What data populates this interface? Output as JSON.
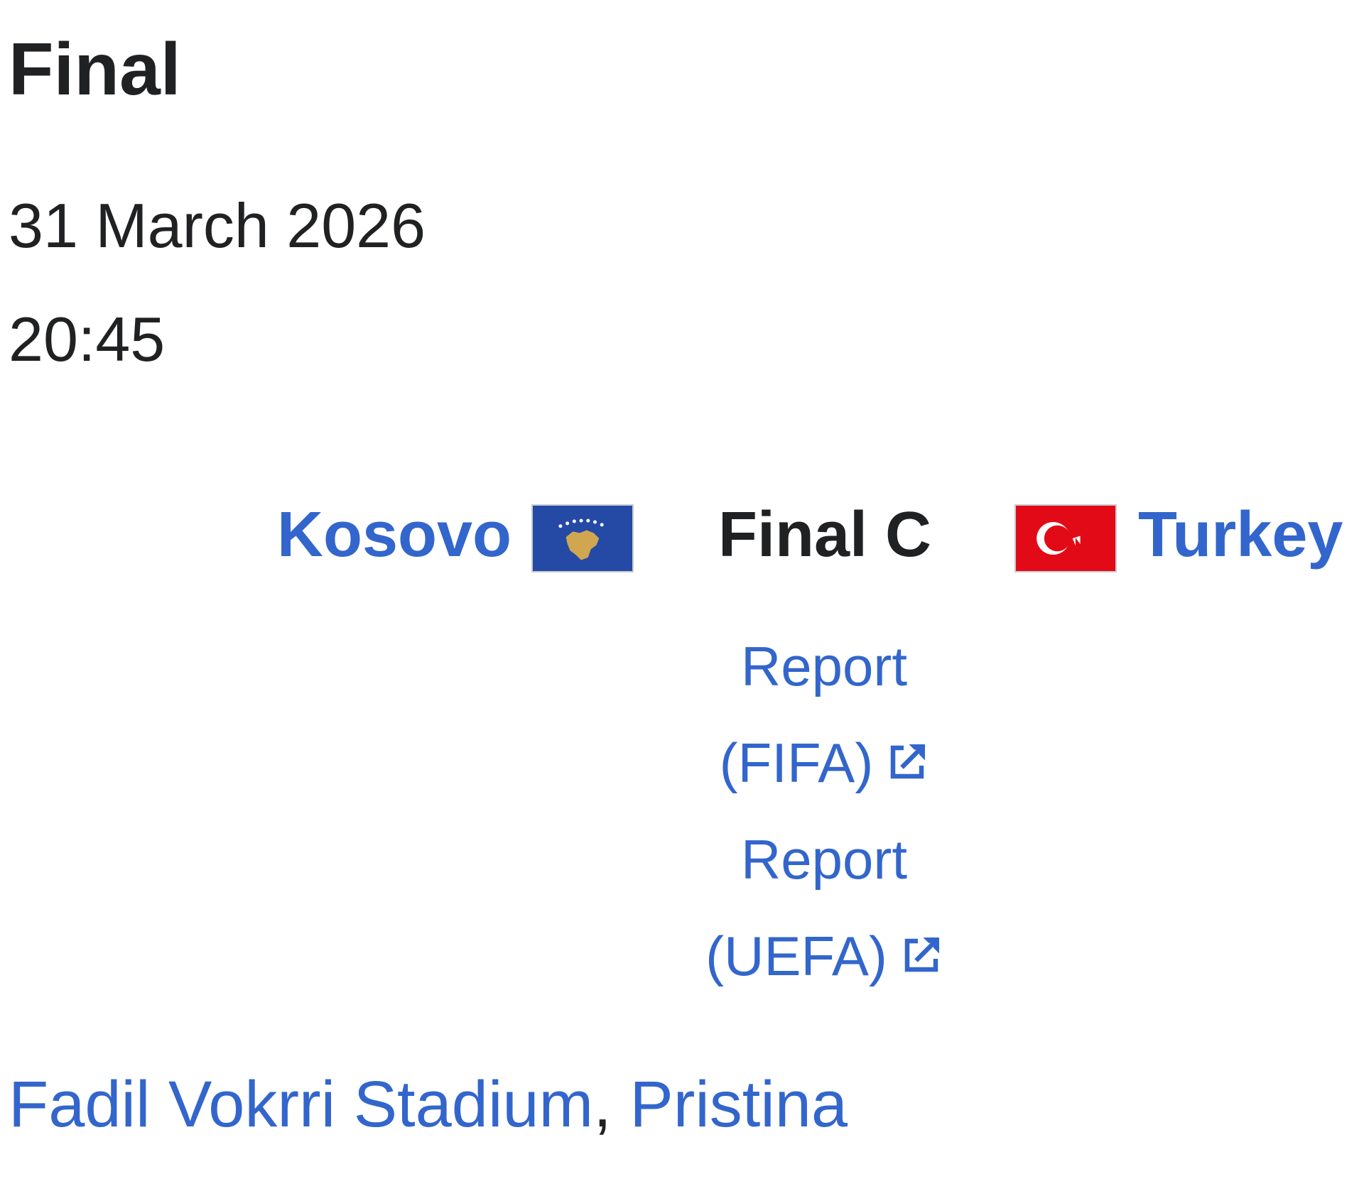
{
  "section": {
    "heading": "Final"
  },
  "match": {
    "date": "31 March 2026",
    "time": "20:45",
    "home_team": {
      "name": "Kosovo",
      "flag_icon": "kosovo-flag-icon"
    },
    "result": "Final C",
    "away_team": {
      "name": "Turkey",
      "flag_icon": "turkey-flag-icon"
    },
    "reports": [
      {
        "line1": "Report",
        "line2": "(FIFA)",
        "icon": "external-link-icon"
      },
      {
        "line1": "Report",
        "line2": "(UEFA)",
        "icon": "external-link-icon"
      }
    ],
    "venue": {
      "stadium": "Fadil Vokrri Stadium",
      "separator": ",",
      "city": "Pristina"
    }
  },
  "colors": {
    "link": "#3366cc",
    "text": "#202122",
    "kosovo_blue": "#244aa5",
    "kosovo_gold": "#d0a650",
    "turkey_red": "#e30a17"
  }
}
